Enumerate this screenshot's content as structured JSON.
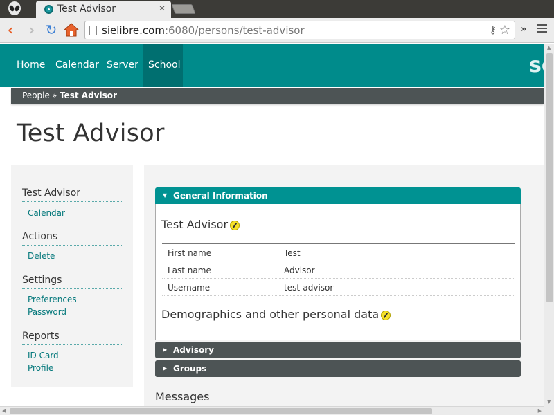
{
  "browser": {
    "tab_title": "Test Advisor",
    "tab_close": "✕",
    "url_host": "sielibre.com",
    "url_rest": ":6080/persons/test-advisor",
    "overflow": "»"
  },
  "site": {
    "nav": [
      "Home",
      "Calendar",
      "Server",
      "School"
    ],
    "active_nav": "School",
    "logo_fragment": "sc",
    "brand_color": "#008b8b"
  },
  "breadcrumb": {
    "parent": "People",
    "separator": "»",
    "current": "Test Advisor"
  },
  "page": {
    "title": "Test Advisor"
  },
  "sidebar": {
    "sections": [
      {
        "heading": "Test Advisor",
        "links": [
          "Calendar"
        ]
      },
      {
        "heading": "Actions",
        "links": [
          "Delete"
        ]
      },
      {
        "heading": "Settings",
        "links": [
          "Preferences",
          "Password"
        ]
      },
      {
        "heading": "Reports",
        "links": [
          "ID Card",
          "Profile"
        ]
      }
    ]
  },
  "panels": {
    "general": {
      "header": "General Information",
      "person_name": "Test Advisor",
      "fields": [
        {
          "label": "First name",
          "value": "Test"
        },
        {
          "label": "Last name",
          "value": "Advisor"
        },
        {
          "label": "Username",
          "value": "test-advisor"
        }
      ],
      "demographics_title": "Demographics and other personal data"
    },
    "advisory": {
      "header": "Advisory"
    },
    "groups": {
      "header": "Groups"
    }
  },
  "messages_heading": "Messages",
  "icons": {
    "back": "back-arrow-icon",
    "forward": "forward-arrow-icon",
    "reload": "reload-icon",
    "home": "home-icon",
    "star": "bookmark-star-icon",
    "edit": "pencil-edit-icon",
    "expand": "triangle-icon"
  }
}
